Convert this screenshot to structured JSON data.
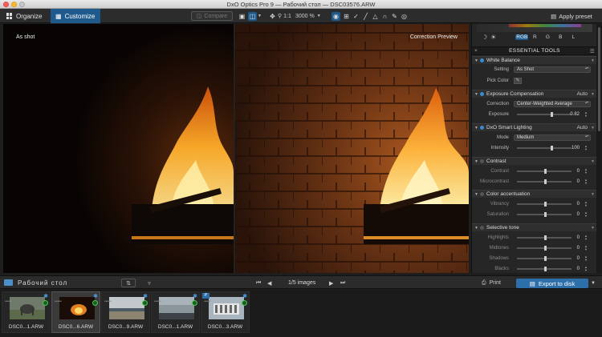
{
  "window": {
    "title": "DxO Optics Pro 9 — Рабочий стол — DSC03576.ARW"
  },
  "toolbar": {
    "tabs": [
      {
        "label": "Organize",
        "icon": "grid-icon"
      },
      {
        "label": "Customize",
        "icon": "customize-icon",
        "active": true
      }
    ],
    "compare_label": "Compare",
    "zoom_1to1": "1:1",
    "zoom_level": "3000 %",
    "apply_preset_label": "Apply preset"
  },
  "viewer": {
    "left_label": "As shot",
    "right_label": "Correction Preview"
  },
  "right_panel": {
    "channels": [
      "RGB",
      "R",
      "G",
      "B",
      "L"
    ],
    "active_channel": "RGB",
    "essential_tools_title": "ESSENTIAL TOOLS",
    "sections": {
      "white_balance": {
        "title": "White Balance",
        "setting_label": "Setting",
        "setting_value": "As Shot",
        "pick_color_label": "Pick Color"
      },
      "exposure": {
        "title": "Exposure Compensation",
        "auto_label": "Auto",
        "correction_label": "Correction",
        "correction_value": "Center-Weighted Average",
        "exposure_label": "Exposure",
        "exposure_value": "0.82",
        "exposure_level": 0.62
      },
      "smart_lighting": {
        "title": "DxO Smart Lighting",
        "auto_label": "Auto",
        "mode_label": "Mode",
        "mode_value": "Medium",
        "intensity_label": "Intensity",
        "intensity_value": "100",
        "intensity_level": 0.62
      },
      "contrast": {
        "title": "Contrast",
        "contrast_label": "Contrast",
        "contrast_value": "0",
        "micro_label": "Microcontrast",
        "micro_value": "0"
      },
      "color_accentuation": {
        "title": "Color accentuation",
        "vibrancy_label": "Vibrancy",
        "vibrancy_value": "0",
        "saturation_label": "Saturation",
        "saturation_value": "0"
      },
      "selective_tone": {
        "title": "Selective tone",
        "highlights_label": "Highlights",
        "highlights_value": "0",
        "midtones_label": "Midtones",
        "midtones_value": "0",
        "shadows_label": "Shadows",
        "shadows_value": "0",
        "blacks_label": "Blacks",
        "blacks_value": "0"
      }
    }
  },
  "bottom_bar": {
    "folder_name": "Рабочий стол",
    "image_count": "1/5 images",
    "print_label": "Print",
    "export_label": "Export to disk"
  },
  "filmstrip": [
    {
      "name": "DSC0...1.ARW",
      "scene": "animal"
    },
    {
      "name": "DSC0...6.ARW",
      "scene": "fire",
      "selected": true
    },
    {
      "name": "DSC0...9.ARW",
      "scene": "field"
    },
    {
      "name": "DSC0...1.ARW",
      "scene": "sky"
    },
    {
      "name": "DSC0...3.ARW",
      "scene": "building",
      "badge": "P"
    }
  ]
}
